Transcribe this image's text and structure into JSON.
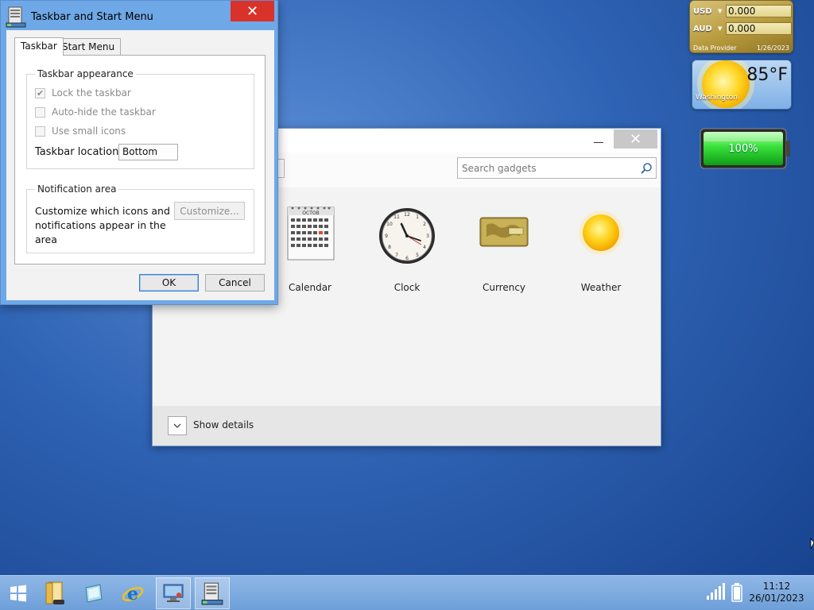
{
  "dialog": {
    "title": "Taskbar and Start Menu",
    "close_glyph": "✕",
    "tabs": [
      {
        "label": "Taskbar",
        "active": true
      },
      {
        "label": "Start Menu",
        "active": false
      }
    ],
    "appearance": {
      "legend": "Taskbar appearance",
      "lock_label": "Lock the taskbar",
      "lock_checked": true,
      "autohide_label": "Auto-hide the taskbar",
      "autohide_checked": false,
      "small_icons_label": "Use small icons",
      "small_icons_checked": false,
      "location_label": "Taskbar location:",
      "location_value": "Bottom"
    },
    "notification": {
      "legend": "Notification area",
      "text": "Customize which icons and notifications appear in the area",
      "customize_label": "Customize..."
    },
    "ok_label": "OK",
    "cancel_label": "Cancel"
  },
  "gadgets_window": {
    "close_glyph": "✕",
    "search_placeholder": "Search gadgets",
    "items": [
      {
        "label": "Calendar",
        "icon": "calendar-icon"
      },
      {
        "label": "Clock",
        "icon": "clock-icon"
      },
      {
        "label": "Currency",
        "icon": "currency-icon"
      },
      {
        "label": "Weather",
        "icon": "weather-icon"
      }
    ],
    "calendar_month": "OCTOB",
    "details_label": "Show details"
  },
  "currency_gadget": {
    "row1": {
      "code": "USD",
      "value": "0.000"
    },
    "row2": {
      "code": "AUD",
      "value": "0.000"
    },
    "provider": "Data Provider",
    "date": "1/26/2023"
  },
  "weather_gadget": {
    "temperature": "85°F",
    "city": "Washington"
  },
  "battery_gadget": {
    "percent": "100%",
    "level": 1.0
  },
  "taskbar": {
    "items": [
      "start-icon",
      "file-explorer-icon",
      "desktop-gadget-icon",
      "internet-explorer-icon",
      "control-panel-icon",
      "taskbar-properties-icon"
    ],
    "time": "11:12",
    "date": "26/01/2023"
  },
  "colors": {
    "close_red": "#d9322a",
    "dialog_frame": "#6fa8e6",
    "taskbar": "#7aa8dd",
    "battery_green": "#2fd636"
  }
}
